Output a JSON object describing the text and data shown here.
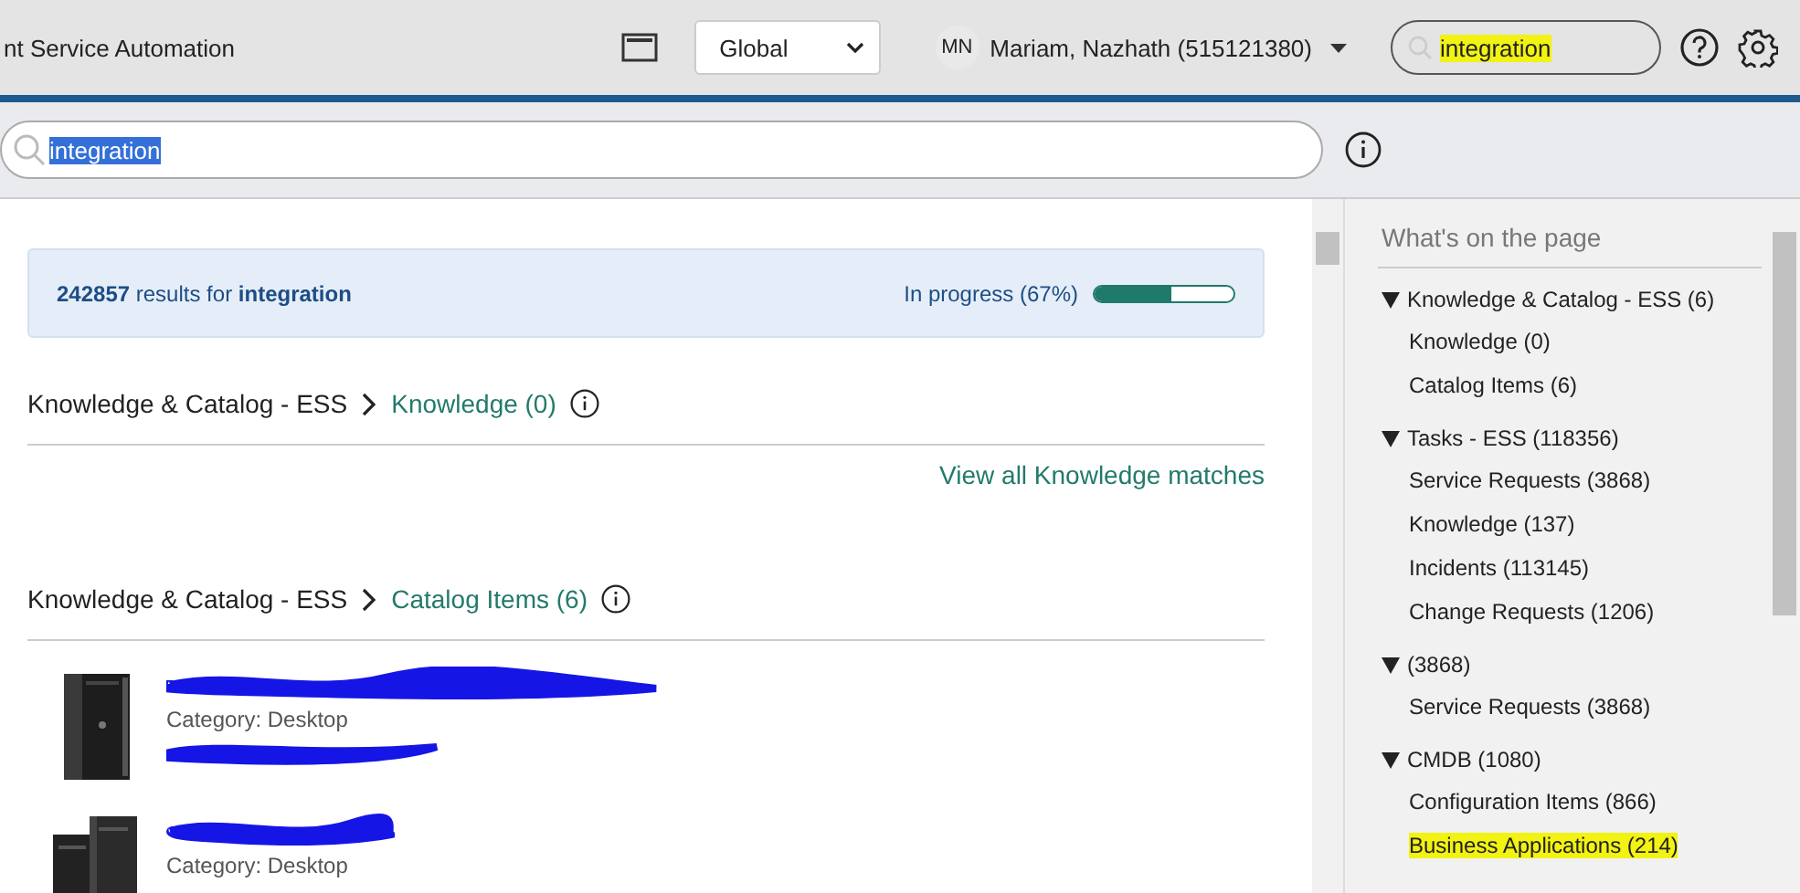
{
  "header": {
    "app_title": "nt Service Automation",
    "scope_select": {
      "value": "Global"
    },
    "user": {
      "initials": "MN",
      "name": "Mariam, Nazhath (515121380)"
    },
    "global_search": {
      "value": "integration",
      "highlighted": true
    }
  },
  "search": {
    "value": "integration",
    "selected": true
  },
  "summary": {
    "count": "242857",
    "text": "results for",
    "query": "integration",
    "status": "In progress (67%)",
    "level": 0.55
  },
  "sections": [
    {
      "breadcrumb": "Knowledge & Catalog - ESS",
      "title": "Knowledge (0)",
      "footer_link": "View all Knowledge matches"
    },
    {
      "breadcrumb": "Knowledge & Catalog - ESS",
      "title": "Catalog Items (6)",
      "items": [
        {
          "category": "Category: Desktop",
          "kind": "tower"
        },
        {
          "category": "Category: Desktop",
          "kind": "mini"
        }
      ]
    }
  ],
  "sidebar": {
    "title": "What's on the page",
    "groups": [
      {
        "label": "Knowledge & Catalog - ESS (6)",
        "expanded": true,
        "children": [
          {
            "label": "Knowledge (0)",
            "highlighted": false
          },
          {
            "label": "Catalog Items (6)",
            "highlighted": false
          }
        ]
      },
      {
        "label": "Tasks - ESS (118356)",
        "expanded": true,
        "children": [
          {
            "label": "Service Requests (3868)",
            "highlighted": false
          },
          {
            "label": "Knowledge (137)",
            "highlighted": false
          },
          {
            "label": "Incidents (113145)",
            "highlighted": false
          },
          {
            "label": "Change Requests (1206)",
            "highlighted": false
          }
        ]
      },
      {
        "label": "(3868)",
        "expanded": true,
        "children": [
          {
            "label": "Service Requests (3868)",
            "highlighted": false
          }
        ]
      },
      {
        "label": "CMDB (1080)",
        "expanded": true,
        "children": [
          {
            "label": "Configuration Items (866)",
            "highlighted": false
          },
          {
            "label": "Business Applications (214)",
            "highlighted": true
          }
        ]
      }
    ]
  }
}
